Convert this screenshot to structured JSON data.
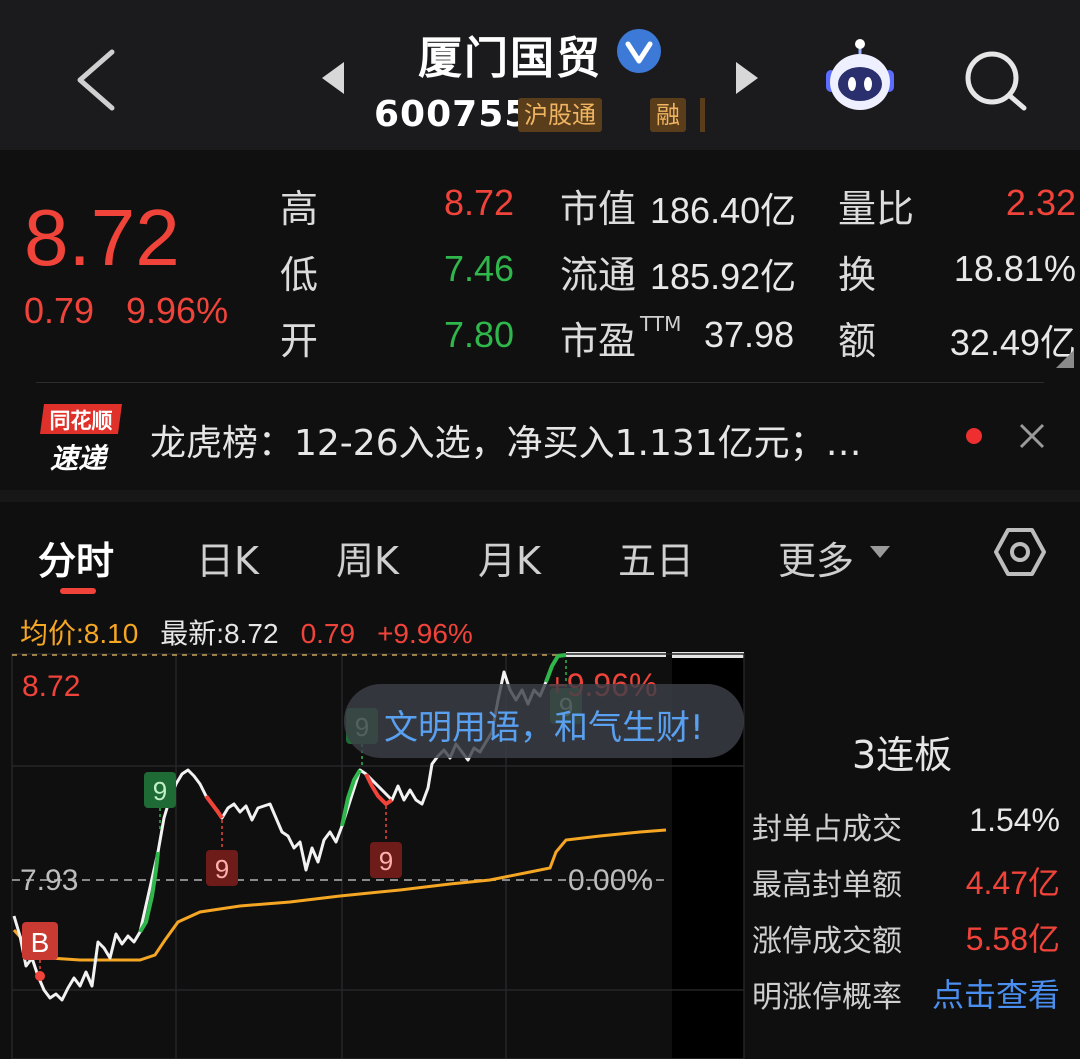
{
  "header": {
    "stock_name": "厦门国贸",
    "stock_code": "600755",
    "badges": [
      "沪股通",
      "融"
    ]
  },
  "quote": {
    "price": "8.72",
    "change": "0.79",
    "change_pct": "9.96%",
    "rows": [
      {
        "label": "高",
        "value": "8.72",
        "color": "#f0433a"
      },
      {
        "label": "低",
        "value": "7.46",
        "color": "#2fb74c"
      },
      {
        "label": "开",
        "value": "7.80",
        "color": "#2fb74c"
      }
    ],
    "mid": [
      {
        "label": "市值",
        "value": "186.40亿"
      },
      {
        "label": "流通",
        "value": "185.92亿"
      },
      {
        "label": "市盈",
        "sup": "TTM",
        "value": "37.98"
      }
    ],
    "right": [
      {
        "label": "量比",
        "value": "2.32",
        "color": "#f0433a"
      },
      {
        "label": "换",
        "value": "18.81%",
        "color": "#e8e8e8"
      },
      {
        "label": "额",
        "value": "32.49亿",
        "color": "#e8e8e8"
      }
    ]
  },
  "news": {
    "logo_top": "同花顺",
    "logo_bottom": "速递",
    "text": "龙虎榜：12-26入选，净买入1.131亿元；…"
  },
  "tabs": [
    "分时",
    "日K",
    "周K",
    "月K",
    "五日",
    "更多"
  ],
  "legend": {
    "avg": "均价:8.10",
    "latest": "最新:8.72",
    "change": "0.79",
    "pct": "+9.96%"
  },
  "chart": {
    "top_price_label": "8.72",
    "top_pct_label": "+9.96%",
    "mid_price_label": "7.93",
    "mid_pct_label": "0.00%",
    "buy_marker": "B",
    "signal_label": "9",
    "colors": {
      "price": "#f2f2f2",
      "avg": "#f5a623",
      "up": "#f0433a",
      "down": "#2fb74c"
    }
  },
  "toast": "文明用语，和气生财!",
  "panel": {
    "title": "3连板",
    "rows": [
      {
        "label": "封单占成交",
        "value": "1.54%",
        "color": "#e8e8e8"
      },
      {
        "label": "最高封单额",
        "value": "4.47亿",
        "color": "#f0433a"
      },
      {
        "label": "涨停成交额",
        "value": "5.58亿",
        "color": "#f0433a"
      },
      {
        "label": "明涨停概率",
        "value": "点击查看",
        "color": "#4a8ff0"
      }
    ]
  }
}
